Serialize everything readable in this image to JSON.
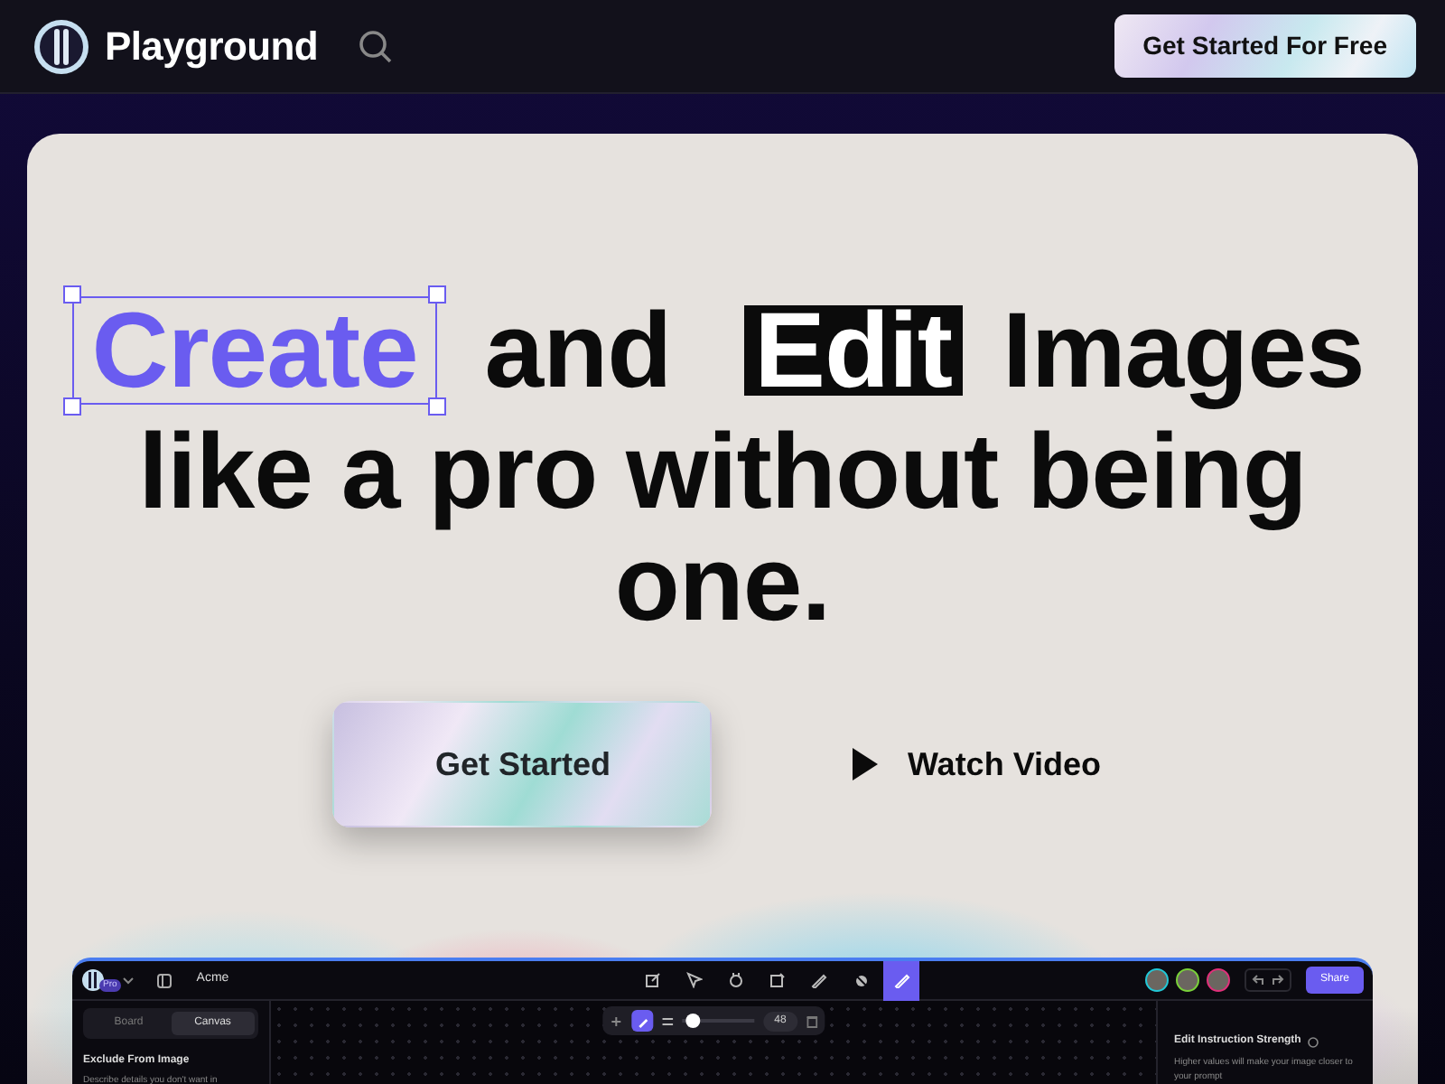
{
  "navbar": {
    "brand": "Playground",
    "cta": "Get Started For Free"
  },
  "hero": {
    "headline_parts": [
      {
        "text": "Create",
        "kind": "selected"
      },
      {
        "text": "and",
        "kind": "plain"
      },
      {
        "text": "Edit",
        "kind": "inverted"
      },
      {
        "text": "Images",
        "kind": "plain"
      },
      {
        "text": "like a pro without being one.",
        "kind": "plain"
      }
    ],
    "primary_button": "Get Started",
    "secondary_button": "Watch Video"
  },
  "app_preview": {
    "badge": "Pro",
    "project": "Acme",
    "tools": [
      {
        "selected": false
      },
      {
        "selected": false
      },
      {
        "selected": false
      },
      {
        "selected": false
      },
      {
        "selected": false
      },
      {
        "selected": false
      },
      {
        "selected": true
      }
    ],
    "avatars": [
      {
        "color": "#22c7d6"
      },
      {
        "color": "#7ad13a"
      },
      {
        "color": "#e0307a"
      }
    ],
    "share": "Share",
    "tabs": [
      {
        "label": "Board",
        "selected": false
      },
      {
        "label": "Canvas",
        "selected": true
      }
    ],
    "section_title": "Exclude From Image",
    "section_text": "Describe details you don't want in",
    "brush": {
      "level": 0.15,
      "value": "48"
    },
    "panel_title": "Edit Instruction Strength",
    "panel_text": "Higher values will make your image closer to your prompt"
  }
}
